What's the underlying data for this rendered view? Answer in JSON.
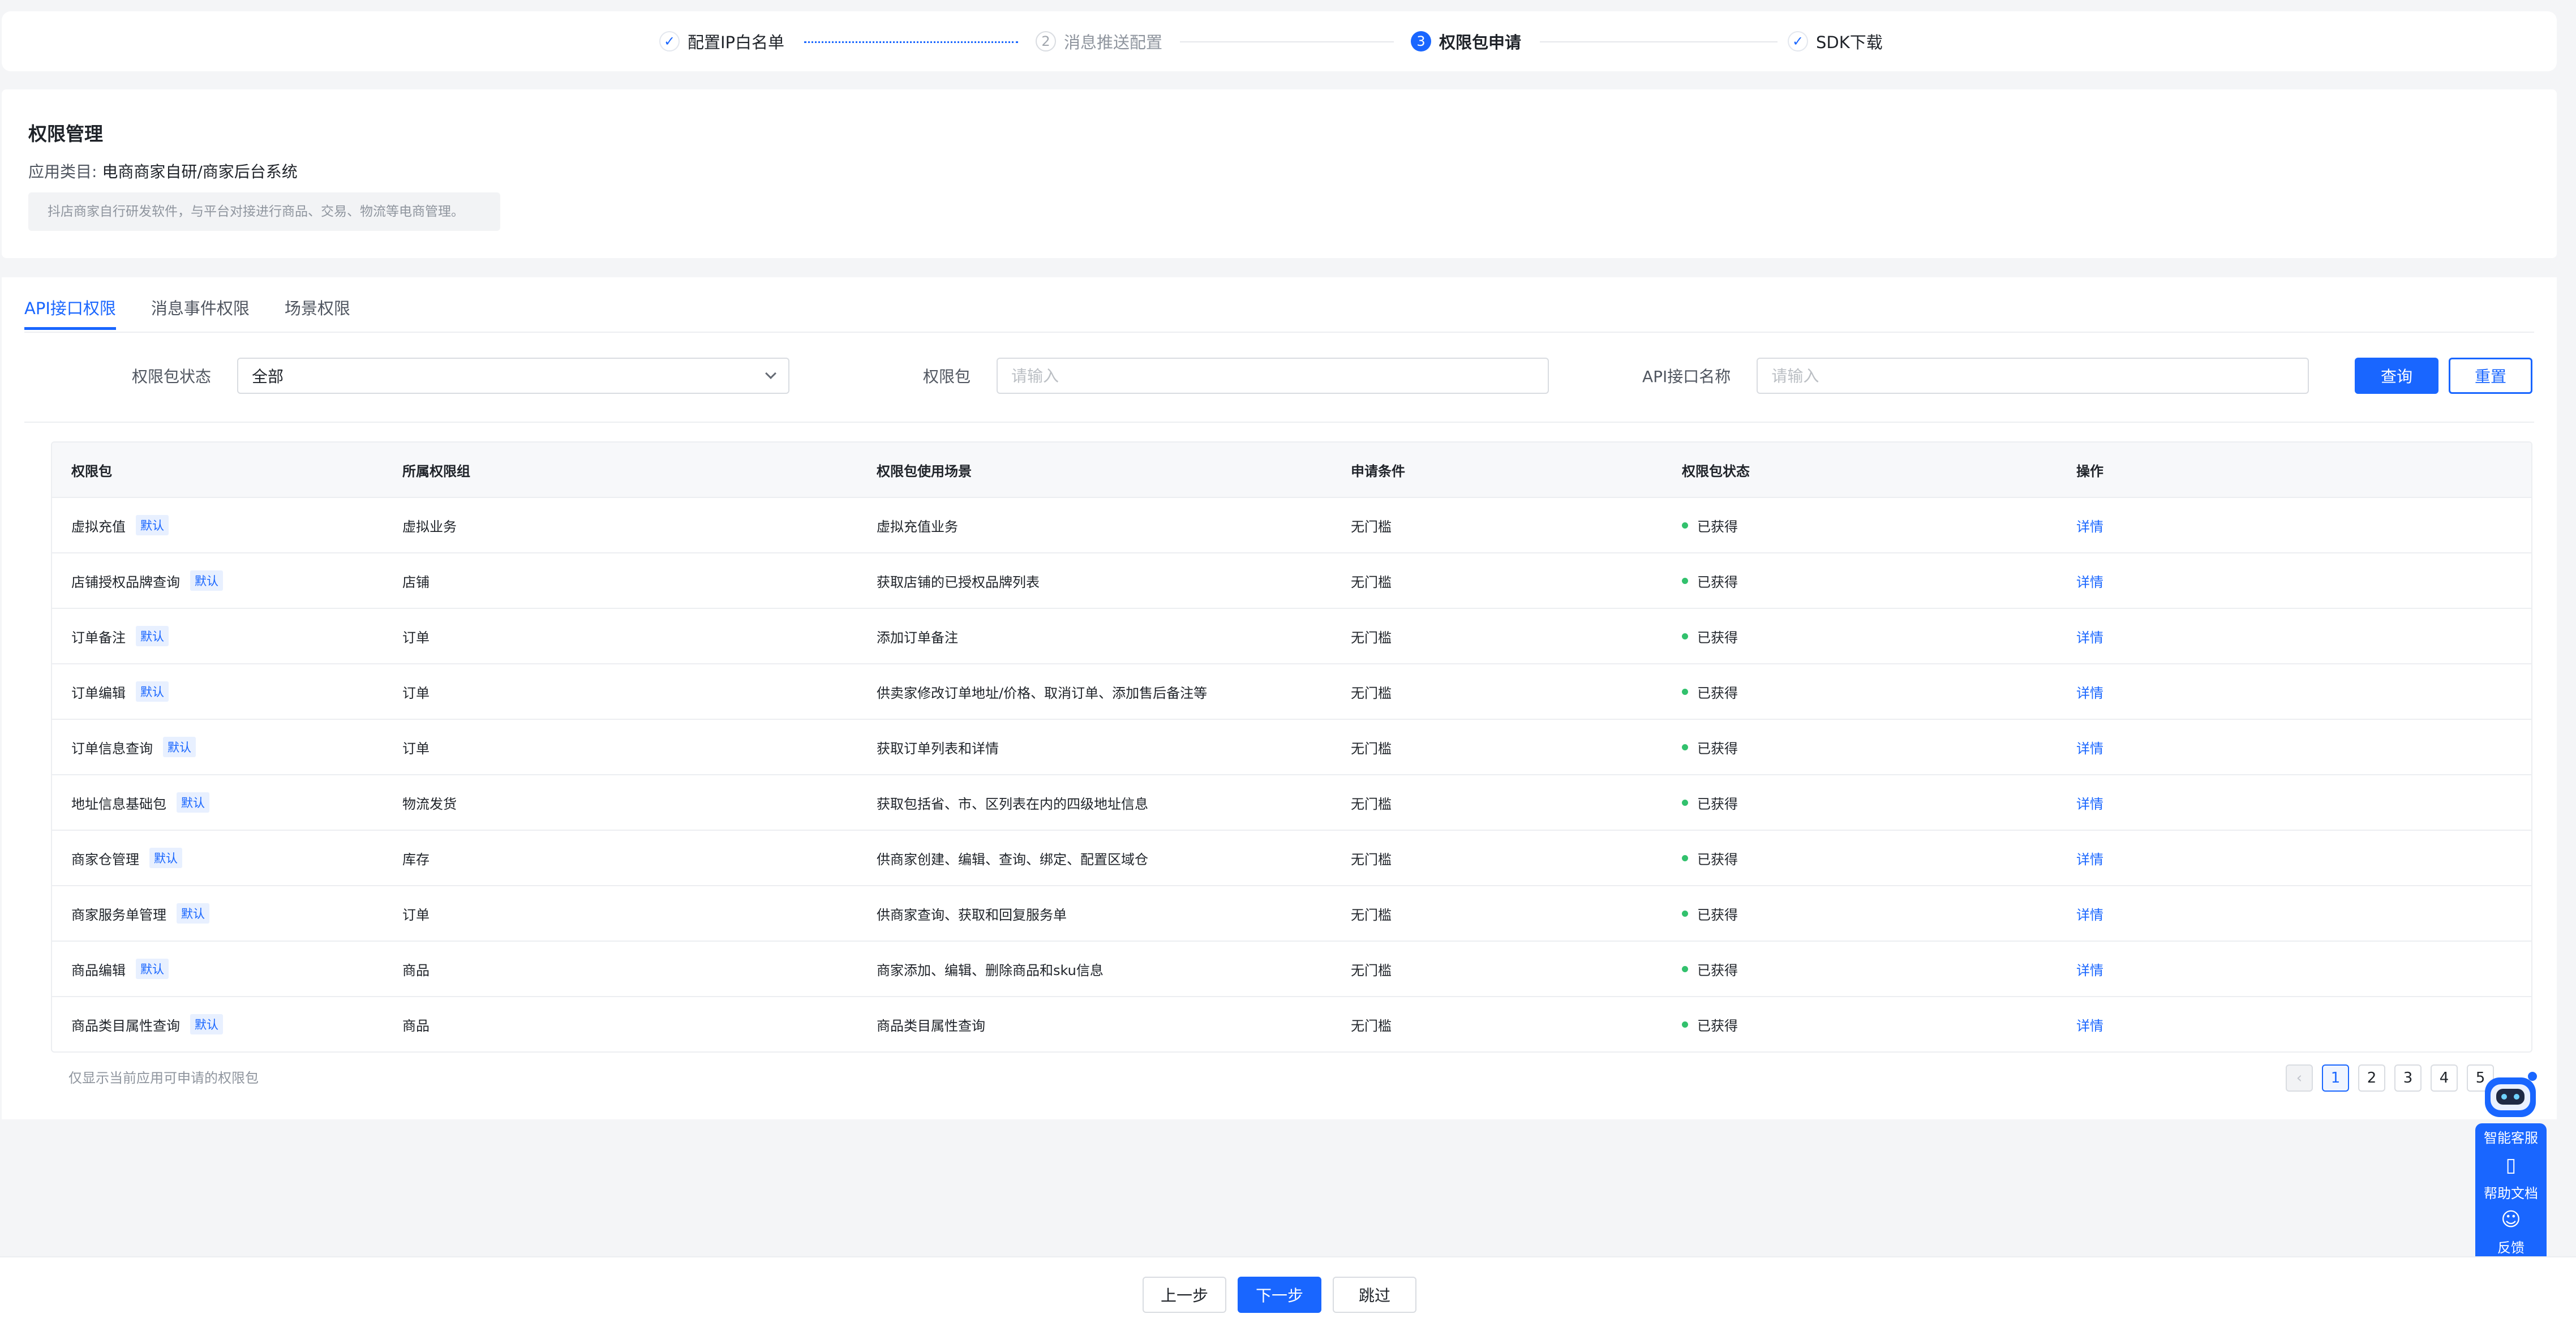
{
  "steps": [
    {
      "label": "配置IP白名单",
      "mark": "✓",
      "state": "done"
    },
    {
      "label": "消息推送配置",
      "mark": "2",
      "state": "wait"
    },
    {
      "label": "权限包申请",
      "mark": "3",
      "state": "active"
    },
    {
      "label": "SDK下载",
      "mark": "✓",
      "state": "done"
    }
  ],
  "permission": {
    "title": "权限管理",
    "category_label": "应用类目:",
    "category_value": "电商商家自研/商家后台系统",
    "description": "抖店商家自行研发软件，与平台对接进行商品、交易、物流等电商管理。"
  },
  "tabs": [
    "API接口权限",
    "消息事件权限",
    "场景权限"
  ],
  "filters": {
    "status_label": "权限包状态",
    "status_value": "全部",
    "package_label": "权限包",
    "package_placeholder": "请输入",
    "api_label": "API接口名称",
    "api_placeholder": "请输入",
    "search_button": "查询",
    "reset_button": "重置"
  },
  "table": {
    "headers": [
      "权限包",
      "所属权限组",
      "权限包使用场景",
      "申请条件",
      "权限包状态",
      "操作"
    ],
    "tag_label": "默认",
    "rows": [
      {
        "name": "虚拟充值",
        "group": "虚拟业务",
        "scene": "虚拟充值业务",
        "condition": "无门槛",
        "status": "已获得",
        "action": "详情"
      },
      {
        "name": "店铺授权品牌查询",
        "group": "店铺",
        "scene": "获取店铺的已授权品牌列表",
        "condition": "无门槛",
        "status": "已获得",
        "action": "详情"
      },
      {
        "name": "订单备注",
        "group": "订单",
        "scene": "添加订单备注",
        "condition": "无门槛",
        "status": "已获得",
        "action": "详情"
      },
      {
        "name": "订单编辑",
        "group": "订单",
        "scene": "供卖家修改订单地址/价格、取消订单、添加售后备注等",
        "condition": "无门槛",
        "status": "已获得",
        "action": "详情"
      },
      {
        "name": "订单信息查询",
        "group": "订单",
        "scene": "获取订单列表和详情",
        "condition": "无门槛",
        "status": "已获得",
        "action": "详情"
      },
      {
        "name": "地址信息基础包",
        "group": "物流发货",
        "scene": "获取包括省、市、区列表在内的四级地址信息",
        "condition": "无门槛",
        "status": "已获得",
        "action": "详情"
      },
      {
        "name": "商家仓管理",
        "group": "库存",
        "scene": "供商家创建、编辑、查询、绑定、配置区域仓",
        "condition": "无门槛",
        "status": "已获得",
        "action": "详情"
      },
      {
        "name": "商家服务单管理",
        "group": "订单",
        "scene": "供商家查询、获取和回复服务单",
        "condition": "无门槛",
        "status": "已获得",
        "action": "详情"
      },
      {
        "name": "商品编辑",
        "group": "商品",
        "scene": "商家添加、编辑、删除商品和sku信息",
        "condition": "无门槛",
        "status": "已获得",
        "action": "详情"
      },
      {
        "name": "商品类目属性查询",
        "group": "商品",
        "scene": "商品类目属性查询",
        "condition": "无门槛",
        "status": "已获得",
        "action": "详情"
      }
    ]
  },
  "footnote": "仅显示当前应用可申请的权限包",
  "pagination": {
    "prev": "‹",
    "pages": [
      "1",
      "2",
      "3",
      "4",
      "5"
    ],
    "current": "1"
  },
  "bottom": {
    "prev_button": "上一步",
    "next_button": "下一步",
    "skip_button": "跳过"
  },
  "widget": {
    "service_label": "智能客服",
    "docs_label": "帮助文档",
    "feedback_label": "反馈"
  },
  "colors": {
    "accent": "#1966ff",
    "success": "#32c16d",
    "background": "#f4f5f7"
  }
}
